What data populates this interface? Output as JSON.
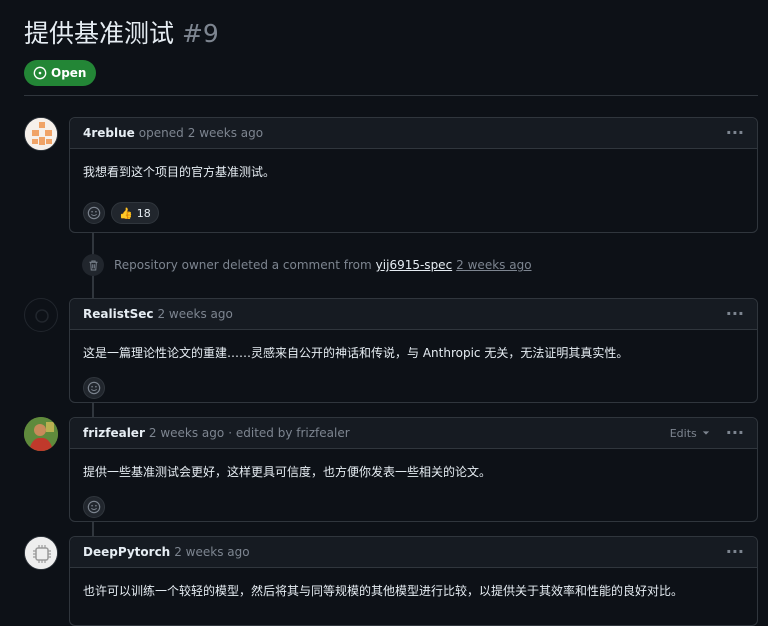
{
  "issue": {
    "title": "提供基准测试",
    "number": "#9",
    "state": "Open"
  },
  "comments": [
    {
      "author": "4reblue",
      "action": "opened",
      "time": "2 weeks ago",
      "edited": "",
      "body": "我想看到这个项目的官方基准测试。",
      "thumbs_up": "18"
    },
    {
      "author": "RealistSec",
      "action": "",
      "time": "2 weeks ago",
      "edited": "",
      "body": "这是一篇理论性论文的重建……灵感来自公开的神话和传说，与 Anthropic 无关，无法证明其真实性。"
    },
    {
      "author": "frizfealer",
      "action": "",
      "time": "2 weeks ago",
      "edited": "· edited by frizfealer",
      "edits_label": "Edits",
      "body": "提供一些基准测试会更好，这样更具可信度，也方便你发表一些相关的论文。"
    },
    {
      "author": "DeepPytorch",
      "action": "",
      "time": "2 weeks ago",
      "edited": "",
      "body": "也许可以训练一个较轻的模型，然后将其与同等规模的其他模型进行比较，以提供关于其效率和性能的良好对比。"
    }
  ],
  "event": {
    "text": "Repository owner deleted a comment from",
    "user": "yij6915-spec",
    "time": "2 weeks ago"
  },
  "colors": {
    "open_green": "#238636",
    "background": "#0d1117",
    "header": "#161b22",
    "border": "#30363d",
    "muted": "#7d8590"
  }
}
